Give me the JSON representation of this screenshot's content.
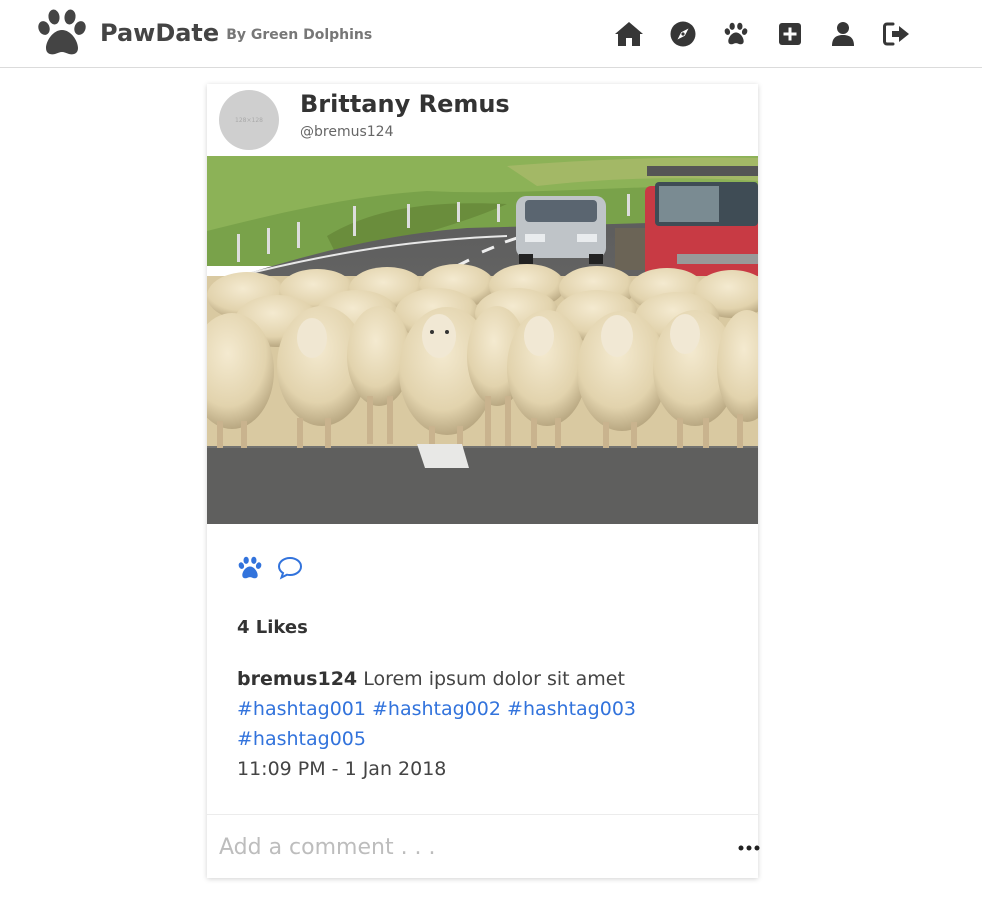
{
  "brand": {
    "name": "PawDate",
    "subtitle": "By Green Dolphins",
    "color": "#444444"
  },
  "nav": {
    "icons": [
      "home-icon",
      "compass-icon",
      "paw-icon",
      "plus-square-icon",
      "user-icon",
      "sign-out-icon"
    ]
  },
  "post": {
    "display_name": "Brittany Remus",
    "handle": "@bremus124",
    "avatar_text": "128×128",
    "image_alt": "Flock of sheep on a road with a car and a red truck",
    "likes": "4 Likes",
    "caption_user": "bremus124",
    "caption_text": "Lorem ipsum dolor sit amet",
    "hashtags": [
      "#hashtag001",
      "#hashtag002",
      "#hashtag003",
      "#hashtag005"
    ],
    "timestamp": "11:09 PM - 1 Jan 2018",
    "comment_placeholder": "Add a comment . . ."
  },
  "colors": {
    "accent": "#3273dc",
    "nav_icon": "#363636"
  }
}
